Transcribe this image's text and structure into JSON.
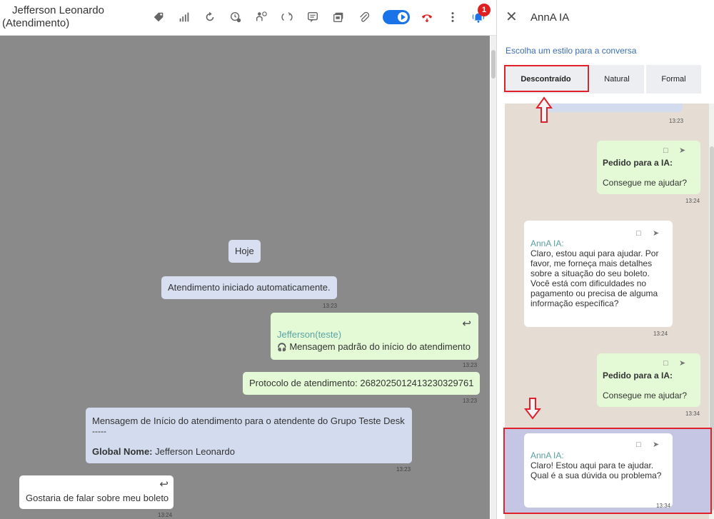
{
  "header": {
    "contact_name": "Jefferson Leonardo",
    "contact_status": "(Atendimento)",
    "notification_count": "1"
  },
  "chat": {
    "day_label": "Hoje",
    "system_auto": "Atendimento iniciado automaticamente.",
    "system_auto_time": "13:23",
    "agent_name": "Jefferson(teste)",
    "agent_message": "Mensagem padrão do início do atendimento",
    "agent_time": "13:23",
    "protocol": "Protocolo de atendimento: 2682025012413230329761",
    "protocol_time": "13:23",
    "start_line": "Mensagem de Início do atendimento para o atendente  do Grupo Teste Desk",
    "start_dashes": "-----",
    "global_label": "Global Nome:",
    "global_value": "Jefferson Leonardo",
    "start_time": "13:23",
    "customer_message": "Gostaria de falar sobre meu boleto",
    "customer_time": "13:24"
  },
  "panel": {
    "title": "AnnA IA",
    "style_hint": "Escolha um estilo para a conversa",
    "styles": [
      "Descontraído",
      "Natural",
      "Formal"
    ],
    "selected_style": "Descontraído",
    "top_cut_time": "13:23",
    "messages": [
      {
        "type": "request",
        "label": "Pedido para a IA:",
        "text": "Consegue me ajudar?",
        "time": "13:24"
      },
      {
        "type": "ai",
        "label": "AnnA IA:",
        "text": "Claro, estou aqui para ajudar. Por favor, me forneça mais detalhes sobre a situação do seu boleto. Você está com dificuldades no pagamento ou precisa de alguma informação específica?",
        "time": "13:24"
      },
      {
        "type": "request",
        "label": "Pedido para a IA:",
        "text": "Consegue me ajudar?",
        "time": "13:34"
      },
      {
        "type": "ai",
        "label": "AnnA IA:",
        "text": "Claro! Estou aqui para te ajudar. Qual é a sua dúvida ou problema?",
        "time": "13:34"
      }
    ]
  },
  "colors": {
    "highlight": "#e0202a",
    "accent_blue": "#1a73e8",
    "chat_bg": "#8a8a8a",
    "system_bubble": "#d7dff0",
    "agent_bubble": "#e4fad6"
  }
}
